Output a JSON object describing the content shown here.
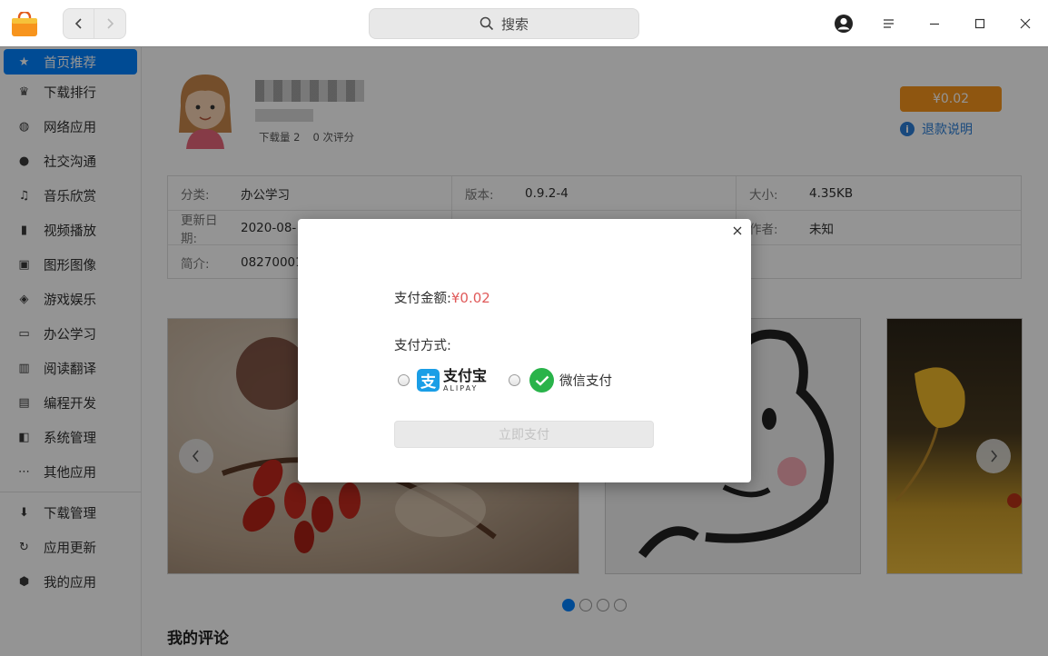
{
  "titlebar": {
    "search_label": "搜索",
    "icons": [
      "back-icon",
      "forward-icon",
      "search-icon",
      "user-icon",
      "menu-icon",
      "minimize-icon",
      "maximize-icon",
      "close-icon"
    ]
  },
  "sidebar": {
    "items": [
      {
        "label": "首页推荐",
        "icon": "star-icon"
      },
      {
        "label": "下载排行",
        "icon": "crown-icon"
      },
      {
        "label": "网络应用",
        "icon": "globe-icon"
      },
      {
        "label": "社交沟通",
        "icon": "chat-icon"
      },
      {
        "label": "音乐欣赏",
        "icon": "music-icon"
      },
      {
        "label": "视频播放",
        "icon": "film-icon"
      },
      {
        "label": "图形图像",
        "icon": "image-icon"
      },
      {
        "label": "游戏娱乐",
        "icon": "gamepad-icon"
      },
      {
        "label": "办公学习",
        "icon": "board-icon"
      },
      {
        "label": "阅读翻译",
        "icon": "book-icon"
      },
      {
        "label": "编程开发",
        "icon": "terminal-icon"
      },
      {
        "label": "系统管理",
        "icon": "system-icon"
      },
      {
        "label": "其他应用",
        "icon": "more-icon"
      }
    ],
    "bottom_items": [
      {
        "label": "下载管理",
        "icon": "download-icon"
      },
      {
        "label": "应用更新",
        "icon": "update-icon"
      },
      {
        "label": "我的应用",
        "icon": "package-icon"
      }
    ]
  },
  "app": {
    "downloads": "下载量 2",
    "ratings": "0 次评分",
    "price": "¥0.02",
    "refund": "退款说明"
  },
  "info": {
    "category_key": "分类:",
    "category_val": "办公学习",
    "version_key": "版本:",
    "version_val": "0.9.2-4",
    "size_key": "大小:",
    "size_val": "4.35KB",
    "updated_key": "更新日期:",
    "updated_val": "2020-08-",
    "author_key": "作者:",
    "author_val": "未知",
    "intro_key": "简介:",
    "intro_val": "08270001"
  },
  "reviews_title": "我的评论",
  "carousel": {
    "dots": 4,
    "active": 0
  },
  "dialog": {
    "amount_label": "支付金额:",
    "amount_value": "¥0.02",
    "method_label": "支付方式:",
    "alipay_cn": "支付宝",
    "alipay_en": "ALIPAY",
    "wechat_label": "微信支付",
    "pay_button": "立即支付"
  },
  "colors": {
    "accent": "#0081ff",
    "price": "#f7941d",
    "amount": "#e05a5a",
    "alipay": "#1a9ee6",
    "wechat": "#29b34a"
  }
}
